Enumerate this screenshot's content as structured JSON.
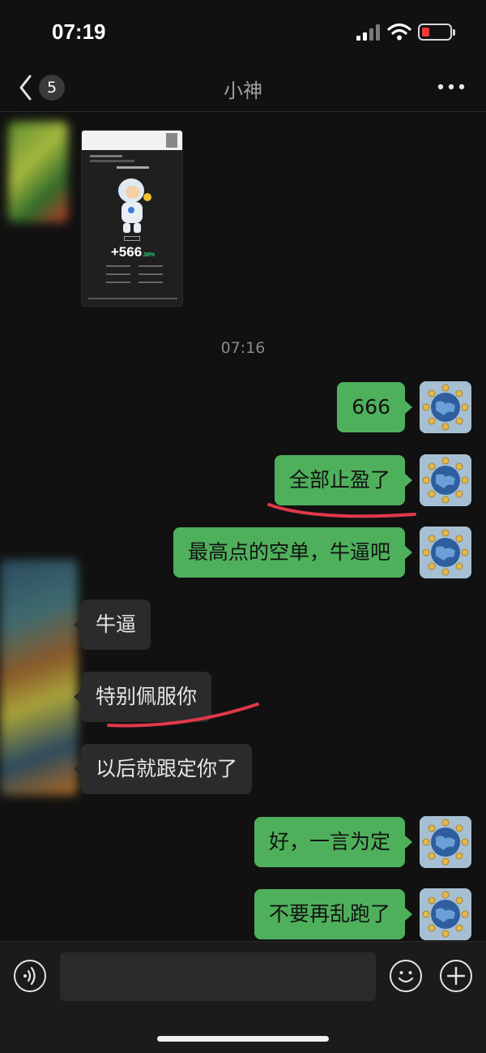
{
  "status_bar": {
    "time": "07:19"
  },
  "nav": {
    "back_count": "5",
    "title": "小神"
  },
  "shared_image": {
    "percent": "+566",
    "percent_decimal": ".38%"
  },
  "timestamp": "07:16",
  "messages": [
    {
      "side": "out",
      "text": "666"
    },
    {
      "side": "out",
      "text": "全部止盈了"
    },
    {
      "side": "out",
      "text": "最高点的空单，牛逼吧"
    },
    {
      "side": "in",
      "text": "牛逼"
    },
    {
      "side": "in",
      "text": "特别佩服你"
    },
    {
      "side": "in",
      "text": "以后就跟定你了"
    },
    {
      "side": "out",
      "text": "好，一言为定"
    },
    {
      "side": "out",
      "text": "不要再乱跑了"
    }
  ],
  "colors": {
    "out_bubble": "#4fb05c",
    "in_bubble": "#2b2b2b",
    "underline": "#e0384a",
    "background": "#111111"
  },
  "icons": [
    "back-chevron-icon",
    "more-dots-icon",
    "voice-icon",
    "emoji-icon",
    "add-icon",
    "globe-bitcoin-icon"
  ]
}
